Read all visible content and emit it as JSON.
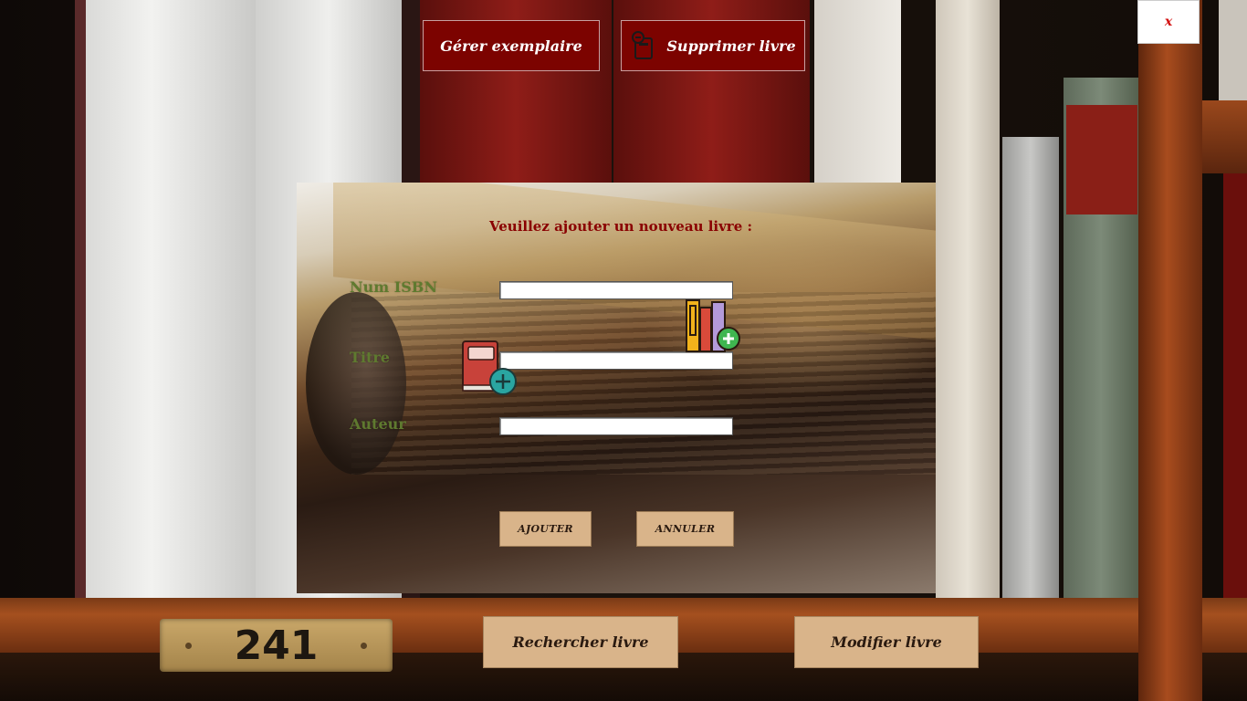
{
  "window": {
    "close_label": "x"
  },
  "toolbar": {
    "manage_copies_label": "Gérer exemplaire",
    "delete_book_label": "Supprimer livre"
  },
  "shelf": {
    "plate_number": "241"
  },
  "form": {
    "title": "Veuillez ajouter un nouveau livre :",
    "fields": [
      {
        "label": "Num ISBN",
        "value": "",
        "placeholder": ""
      },
      {
        "label": "Titre",
        "value": "",
        "placeholder": ""
      },
      {
        "label": "Auteur",
        "value": "",
        "placeholder": ""
      }
    ],
    "submit_label": "AJOUTER",
    "cancel_label": "ANNULER"
  },
  "footer": {
    "search_label": "Rechercher livre",
    "edit_label": "Modifier livre"
  },
  "icons": [
    "delete-book-icon",
    "books-add-icon",
    "book-add-icon"
  ],
  "colors": {
    "primary_button": "#7c0300",
    "secondary_button": "#d9b48a",
    "title_text": "#8a0000",
    "field_label": "#5f7a2f",
    "close_text": "#d31010"
  }
}
